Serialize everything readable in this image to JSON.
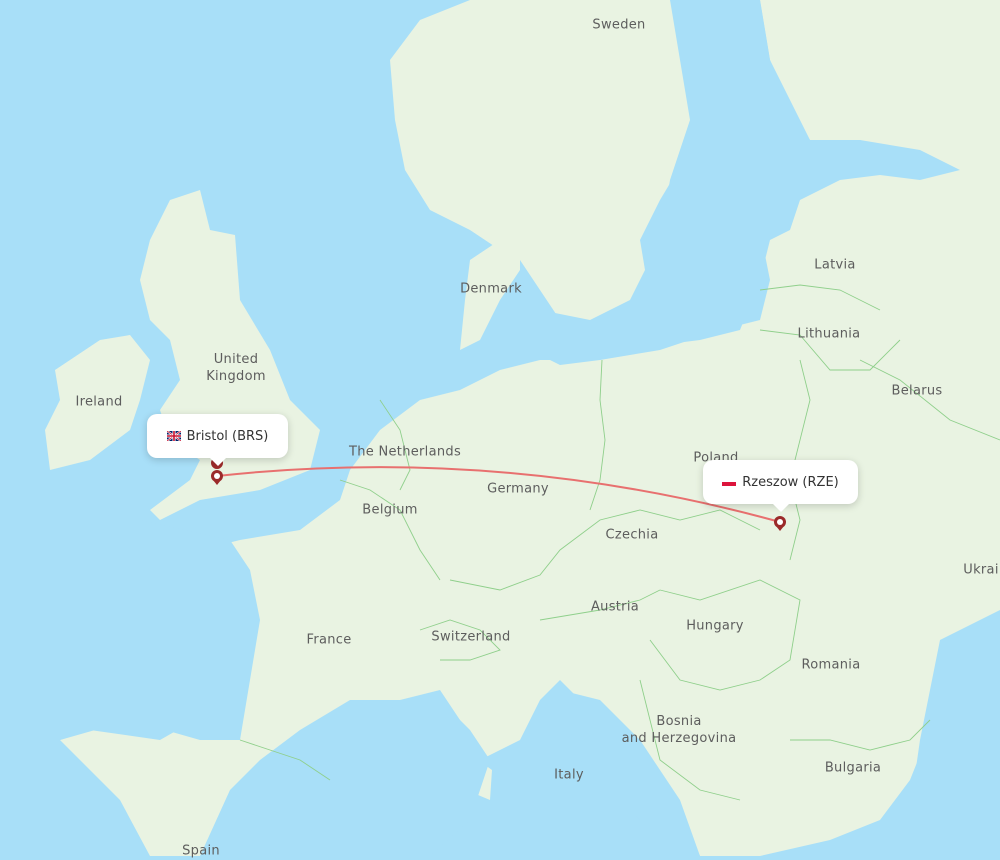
{
  "map": {
    "route": {
      "origin": {
        "city": "Bristol",
        "code": "BRS",
        "label": "Bristol (BRS)",
        "flag": "uk-flag-icon",
        "country": "United Kingdom"
      },
      "destination": {
        "city": "Rzeszow",
        "code": "RZE",
        "label": "Rzeszow (RZE)",
        "flag": "poland-flag-icon",
        "country": "Poland"
      },
      "line_color": "#e8706f",
      "marker_color": "#9b2a2a"
    },
    "colors": {
      "water": "#a8dff8",
      "land": "#e9f3e2",
      "border": "#8fcf8b"
    },
    "country_labels": [
      {
        "id": "sweden",
        "text": "Sweden"
      },
      {
        "id": "denmark",
        "text": "Denmark"
      },
      {
        "id": "latvia",
        "text": "Latvia"
      },
      {
        "id": "lithuania",
        "text": "Lithuania"
      },
      {
        "id": "united-kingdom",
        "text": "United\nKingdom"
      },
      {
        "id": "ireland",
        "text": "Ireland"
      },
      {
        "id": "belarus",
        "text": "Belarus"
      },
      {
        "id": "the-netherlands",
        "text": "The Netherlands"
      },
      {
        "id": "poland",
        "text": "Poland"
      },
      {
        "id": "germany",
        "text": "Germany"
      },
      {
        "id": "belgium",
        "text": "Belgium"
      },
      {
        "id": "czechia",
        "text": "Czechia"
      },
      {
        "id": "ukraine",
        "text": "Ukrai"
      },
      {
        "id": "austria",
        "text": "Austria"
      },
      {
        "id": "hungary",
        "text": "Hungary"
      },
      {
        "id": "france",
        "text": "France"
      },
      {
        "id": "switzerland",
        "text": "Switzerland"
      },
      {
        "id": "romania",
        "text": "Romania"
      },
      {
        "id": "bosnia",
        "text": "Bosnia\nand Herzegovina"
      },
      {
        "id": "bulgaria",
        "text": "Bulgaria"
      },
      {
        "id": "italy",
        "text": "Italy"
      },
      {
        "id": "spain",
        "text": "Spain"
      }
    ]
  }
}
